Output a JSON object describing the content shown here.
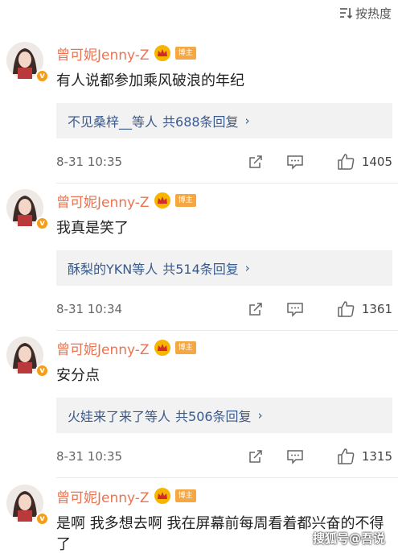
{
  "sort": {
    "label": "按热度",
    "icon": "sort-icon"
  },
  "comments": [
    {
      "username": "曾可妮Jenny-Z",
      "tag": "博主",
      "text": "有人说都参加乘风破浪的年纪",
      "reply_names": "不见桑梓__等人",
      "reply_count": "共688条回复",
      "time": "8-31 10:35",
      "likes": "1405"
    },
    {
      "username": "曾可妮Jenny-Z",
      "tag": "博主",
      "text": "我真是笑了",
      "reply_names": "酥梨的YKN等人",
      "reply_count": "共514条回复",
      "time": "8-31 10:34",
      "likes": "1361"
    },
    {
      "username": "曾可妮Jenny-Z",
      "tag": "博主",
      "text": "安分点",
      "reply_names": "火娃来了来了等人",
      "reply_count": "共506条回复",
      "time": "8-31 10:35",
      "likes": "1315"
    },
    {
      "username": "曾可妮Jenny-Z",
      "tag": "博主",
      "text": "是啊 我多想去啊 我在屏幕前每周看着都兴奋的不得了"
    }
  ],
  "watermark": "搜狐号@吾说",
  "colors": {
    "username": "#eb7350",
    "reply": "#3a5a8c",
    "crown": "#f7b500",
    "tag": "#f5a742",
    "verified": "#f59c18"
  }
}
